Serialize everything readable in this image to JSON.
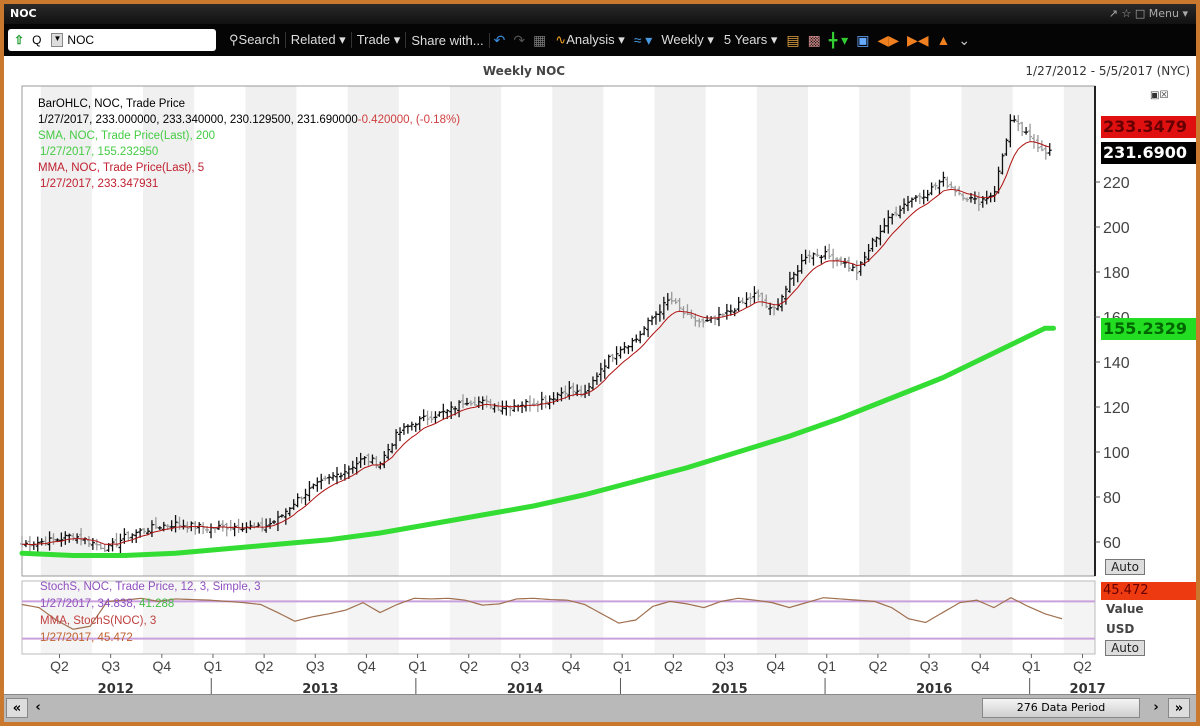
{
  "window": {
    "title": "NOC",
    "menu_label": "Menu ▾"
  },
  "toolbar": {
    "security": "NOC",
    "market": "Q",
    "search": "Search",
    "related": "Related ▾",
    "trade": "Trade ▾",
    "share": "Share with...",
    "analysis": "Analysis ▾",
    "frequency": "Weekly ▾",
    "range": "5 Years ▾"
  },
  "chart_header": {
    "title": "Weekly NOC",
    "date_range": "1/27/2012 - 5/5/2017 (NYC)"
  },
  "legend": {
    "bar_title": "BarOHLC, NOC, Trade Price",
    "bar_values": "1/27/2017, 233.000000, 233.340000, 230.129500, 231.690000",
    "bar_change": "-0.420000, (-0.18%)",
    "sma_title": "SMA, NOC, Trade Price(Last),  200",
    "sma_value": "1/27/2017, 155.232950",
    "mma_title": "MMA, NOC, Trade Price(Last),  5",
    "mma_value": "1/27/2017, 233.347931",
    "stoch_title": "StochS, NOC, Trade Price,  12, 3, Simple, 3",
    "stoch_value_a": "1/27/2017, 34.838,",
    "stoch_value_b": " 41.288",
    "stoch_mma_title": "MMA, StochS(NOC),  3",
    "stoch_mma_value": "1/27/2017, 45.472"
  },
  "tags": {
    "mma": "233.3479",
    "last": "231.6900",
    "sma": "155.2329",
    "stoch": "45.472"
  },
  "lower_axis": {
    "value_label": "Value",
    "currency_label": "USD",
    "auto": "Auto"
  },
  "scroll": {
    "period": "276 Data Period",
    "first": "«",
    "prev": "‹",
    "next": "›",
    "last": "»"
  },
  "colors": {
    "sma": "#33dd33",
    "mma": "#b01010",
    "stoch": "#a07050",
    "band": "#c9a0dc",
    "mma_tag": "#e01010",
    "sma_tag": "#22dd22",
    "stoch_tag": "#ee3a10"
  },
  "chart_data": {
    "type": "line",
    "title": "Weekly NOC",
    "ylim": [
      50,
      260
    ],
    "yticks": [
      60,
      80,
      100,
      120,
      140,
      160,
      180,
      200,
      220
    ],
    "x_quarter_labels": [
      "Q2",
      "Q3",
      "Q4",
      "Q1",
      "Q2",
      "Q3",
      "Q4",
      "Q1",
      "Q2",
      "Q3",
      "Q4",
      "Q1",
      "Q2",
      "Q3",
      "Q4",
      "Q1",
      "Q2",
      "Q3",
      "Q4",
      "Q1",
      "Q2"
    ],
    "x_year_labels": [
      "2012",
      "2013",
      "2014",
      "2015",
      "2016",
      "2017"
    ],
    "x_unit": "months since Jan 2012 (monthly approximate closes)",
    "price_monthly_close": [
      59,
      60,
      61,
      63,
      60,
      57,
      62,
      65,
      67,
      68,
      67,
      66,
      67,
      67,
      66,
      70,
      78,
      84,
      88,
      92,
      97,
      95,
      108,
      113,
      116,
      118,
      123,
      122,
      120,
      121,
      122,
      124,
      128,
      125,
      138,
      146,
      150,
      160,
      168,
      160,
      157,
      160,
      165,
      170,
      162,
      175,
      188,
      188,
      185,
      180,
      195,
      205,
      212,
      215,
      221,
      215,
      211,
      215,
      248,
      240,
      234,
      232
    ],
    "sma200_quarterly": [
      55,
      54,
      54,
      55,
      57,
      59,
      61,
      64,
      68,
      72,
      76,
      81,
      87,
      93,
      100,
      107,
      115,
      124,
      133,
      144,
      155
    ],
    "stoch_monthly": [
      75,
      70,
      50,
      35,
      40,
      80,
      82,
      85,
      80,
      84,
      83,
      82,
      80,
      78,
      75,
      62,
      48,
      55,
      60,
      66,
      78,
      62,
      75,
      85,
      84,
      85,
      82,
      74,
      76,
      84,
      85,
      83,
      82,
      75,
      60,
      45,
      50,
      72,
      80,
      76,
      70,
      80,
      85,
      82,
      78,
      70,
      78,
      86,
      84,
      82,
      80,
      70,
      52,
      46,
      62,
      78,
      82,
      70,
      86,
      72,
      60,
      52
    ],
    "stoch_bands": [
      80,
      20
    ]
  }
}
